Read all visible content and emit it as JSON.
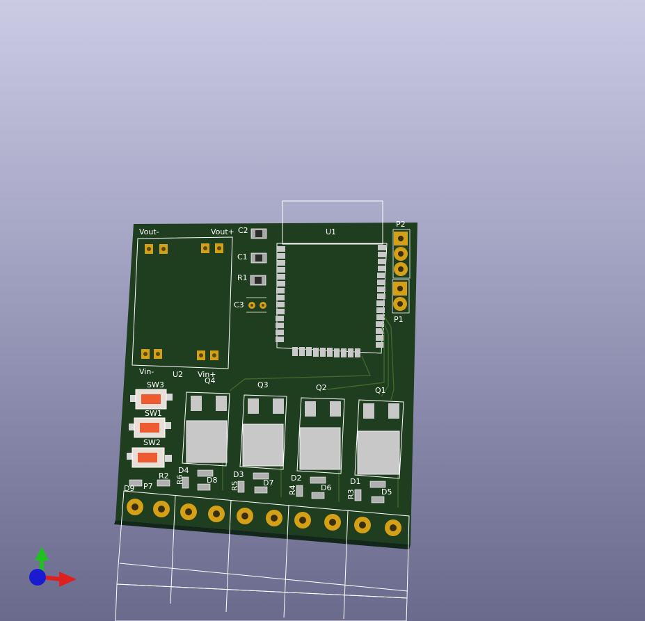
{
  "viewer": {
    "view": "3D Viewer"
  },
  "board": {
    "substrate_color": "#1f3d1f",
    "copper_pad_color": "#d4a017",
    "silk_color": "#ffffff",
    "switch_color": "#ef5b30"
  },
  "labels": {
    "vout_minus": "Vout-",
    "vout_plus": "Vout+",
    "vin_minus": "Vin-",
    "vin_plus": "Vin+",
    "u1": "U1",
    "u2": "U2",
    "c1": "C1",
    "c2": "C2",
    "c3": "C3",
    "r1": "R1",
    "r2": "R2",
    "r3": "R3",
    "r4": "R4",
    "r5": "R5",
    "r6": "R6",
    "p1": "P1",
    "p2": "P2",
    "p7": "P7",
    "q1": "Q1",
    "q2": "Q2",
    "q3": "Q3",
    "q4": "Q4",
    "sw1": "SW1",
    "sw2": "SW2",
    "sw3": "SW3",
    "d1": "D1",
    "d2": "D2",
    "d3": "D3",
    "d4": "D4",
    "d5": "D5",
    "d6": "D6",
    "d7": "D7",
    "d8": "D8",
    "d9": "D9"
  },
  "axes": {
    "x_color": "#e02020",
    "y_color": "#20c020",
    "z_color": "#2020d0"
  }
}
